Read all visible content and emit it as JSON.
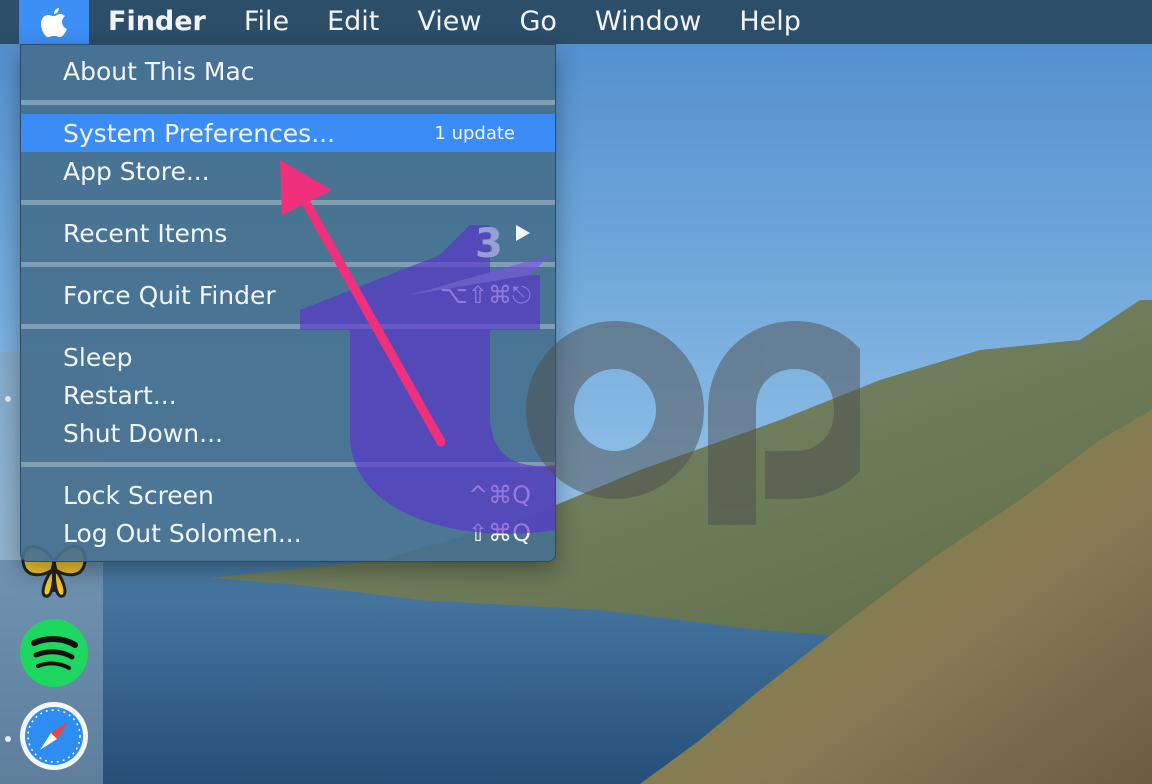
{
  "menubar": {
    "apple_icon": "apple-logo-icon",
    "items": [
      "Finder",
      "File",
      "Edit",
      "View",
      "Go",
      "Window",
      "Help"
    ]
  },
  "apple_menu": {
    "about": "About This Mac",
    "system_preferences": "System Preferences...",
    "system_preferences_badge": "1 update",
    "app_store": "App Store...",
    "recent_items": "Recent Items",
    "recent_items_submenu_icon": "triangle-right-icon",
    "force_quit": "Force Quit Finder",
    "force_quit_shortcut": "⌥⇧⌘⎋",
    "sleep": "Sleep",
    "restart": "Restart...",
    "shut_down": "Shut Down...",
    "lock_screen": "Lock Screen",
    "lock_screen_shortcut": "^⌘Q",
    "log_out": "Log Out Solomen...",
    "log_out_shortcut": "⇧⌘Q"
  },
  "dock": {
    "apps": [
      "butterfly-app-icon",
      "spotify-icon",
      "safari-icon"
    ]
  },
  "colors": {
    "menubar": "#2c4e69",
    "highlight": "#3b8df5",
    "annotation_arrow": "#f0307a",
    "watermark": "#5a2fd0"
  }
}
